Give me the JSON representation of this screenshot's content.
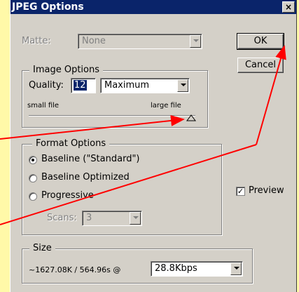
{
  "dialog": {
    "title": "JPEG Options",
    "close_glyph": "×"
  },
  "matte": {
    "label": "Matte:",
    "value": "None"
  },
  "buttons": {
    "ok": "OK",
    "cancel": "Cancel"
  },
  "image_options": {
    "legend": "Image Options",
    "quality_label": "Quality:",
    "quality_value": "12",
    "quality_preset": "Maximum",
    "slider_min_label": "small file",
    "slider_max_label": "large file"
  },
  "format_options": {
    "legend": "Format Options",
    "options": [
      {
        "label": "Baseline (\"Standard\")",
        "selected": true
      },
      {
        "label": "Baseline Optimized",
        "selected": false
      },
      {
        "label": "Progressive",
        "selected": false
      }
    ],
    "scans_label": "Scans:",
    "scans_value": "3"
  },
  "preview": {
    "label": "Preview",
    "checked": true,
    "check_glyph": "✓"
  },
  "size": {
    "legend": "Size",
    "estimate": "~1627.08K / 564.96s @",
    "speed": "28.8Kbps"
  },
  "colors": {
    "annotation_arrow": "#ff0000",
    "background": "#fff9a8",
    "title_bar": "#0a246a"
  }
}
